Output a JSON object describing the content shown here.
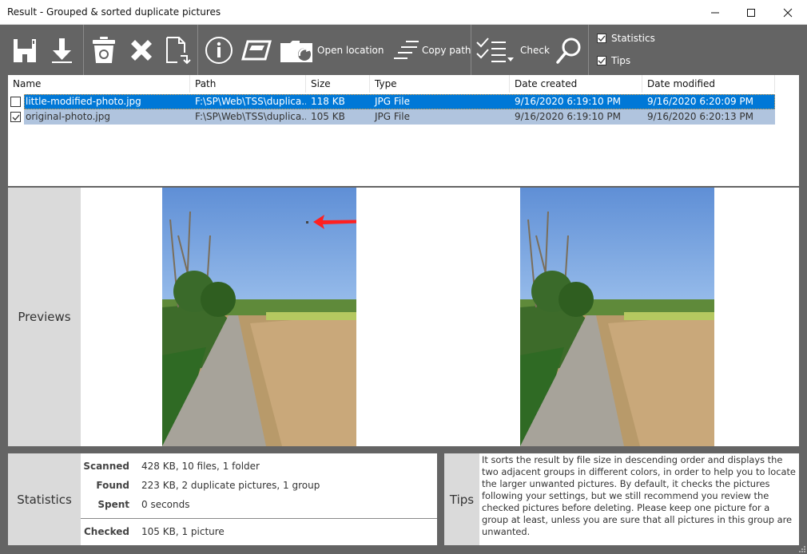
{
  "window": {
    "title": "Result - Grouped & sorted duplicate pictures",
    "controls": {
      "minimize": "minimize",
      "maximize": "maximize",
      "close": "close"
    }
  },
  "toolbar": {
    "buttons": [
      {
        "icon": "save-icon",
        "label": ""
      },
      {
        "icon": "download-icon",
        "label": ""
      },
      {
        "icon": "recycle-bin-icon",
        "label": ""
      },
      {
        "icon": "delete-x-icon",
        "label": ""
      },
      {
        "icon": "move-file-icon",
        "label": ""
      },
      {
        "icon": "info-icon",
        "label": ""
      },
      {
        "icon": "preview-icon",
        "label": ""
      },
      {
        "icon": "open-folder-icon",
        "label": "Open location"
      },
      {
        "icon": "copy-path-icon",
        "label": "Copy path"
      },
      {
        "icon": "checklist-icon",
        "label": "Check"
      },
      {
        "icon": "search-icon",
        "label": ""
      }
    ],
    "toggles": [
      {
        "label": "Statistics",
        "checked": true
      },
      {
        "label": "Tips",
        "checked": true
      }
    ]
  },
  "list": {
    "columns": [
      "Name",
      "Path",
      "Size",
      "Type",
      "Date created",
      "Date modified"
    ],
    "rows": [
      {
        "checked": false,
        "selected": true,
        "name": "little-modified-photo.jpg",
        "path": "F:\\SP\\Web\\TSS\\duplica...",
        "size": "118 KB",
        "type": "JPG File",
        "created": "9/16/2020 6:19:10 PM",
        "modified": "9/16/2020 6:20:09 PM"
      },
      {
        "checked": true,
        "selected": false,
        "name": "original-photo.jpg",
        "path": "F:\\SP\\Web\\TSS\\duplica...",
        "size": "105 KB",
        "type": "JPG File",
        "created": "9/16/2020 6:19:10 PM",
        "modified": "9/16/2020 6:20:13 PM"
      }
    ]
  },
  "previews": {
    "label": "Previews",
    "annotation": "red-arrow pointing at small mark in sky"
  },
  "statistics": {
    "label": "Statistics",
    "rows": [
      {
        "key": "Scanned",
        "value": "428 KB, 10 files, 1 folder"
      },
      {
        "key": "Found",
        "value": "223 KB, 2 duplicate pictures, 1 group"
      },
      {
        "key": "Spent",
        "value": "0 seconds"
      },
      {
        "key": "Checked",
        "value": "105 KB, 1 picture"
      }
    ]
  },
  "tips": {
    "label": "Tips",
    "text": "It sorts the result by file size in descending order and displays the two adjacent groups in different colors, in order to help you to locate the larger unwanted pictures. By default, it checks the pictures following your settings, but we still recommend you review the checked pictures before deleting. Please keep one picture for a group at least, unless you are sure that all pictures in this group are unwanted."
  },
  "colors": {
    "toolbar_bg": "#646464",
    "selection": "#0078d7",
    "group_alt": "#b0c4de",
    "side_panel": "#dadada",
    "arrow": "#ff2020"
  }
}
